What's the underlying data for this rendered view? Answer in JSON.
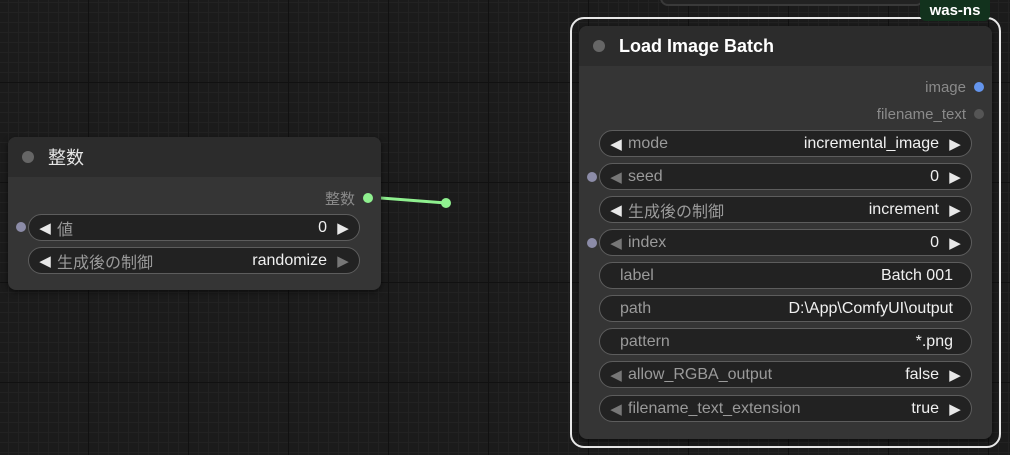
{
  "colors": {
    "canvas": "#1b1b1b",
    "node_body": "#353535",
    "node_header": "#2c2c2c",
    "link": "#8ff08f",
    "image_socket": "#6495ed",
    "badge_bg": "#12321d"
  },
  "int_node": {
    "title": "整数",
    "output_label": "整数",
    "widgets": [
      {
        "label": "値",
        "value": "0"
      },
      {
        "label": "生成後の制御",
        "value": "randomize"
      }
    ]
  },
  "batch_node": {
    "title": "Load Image Batch",
    "badge": "was-ns",
    "outputs": [
      {
        "label": "image",
        "type": "IMAGE"
      },
      {
        "label": "filename_text",
        "type": "STRING"
      }
    ],
    "widgets": [
      {
        "label": "mode",
        "value": "incremental_image"
      },
      {
        "label": "seed",
        "value": "0"
      },
      {
        "label": "生成後の制御",
        "value": "increment"
      },
      {
        "label": "index",
        "value": "0"
      },
      {
        "label": "label",
        "value": "Batch 001"
      },
      {
        "label": "path",
        "value": "D:\\App\\ComfyUI\\output"
      },
      {
        "label": "pattern",
        "value": "*.png"
      },
      {
        "label": "allow_RGBA_output",
        "value": "false"
      },
      {
        "label": "filename_text_extension",
        "value": "true"
      }
    ]
  }
}
